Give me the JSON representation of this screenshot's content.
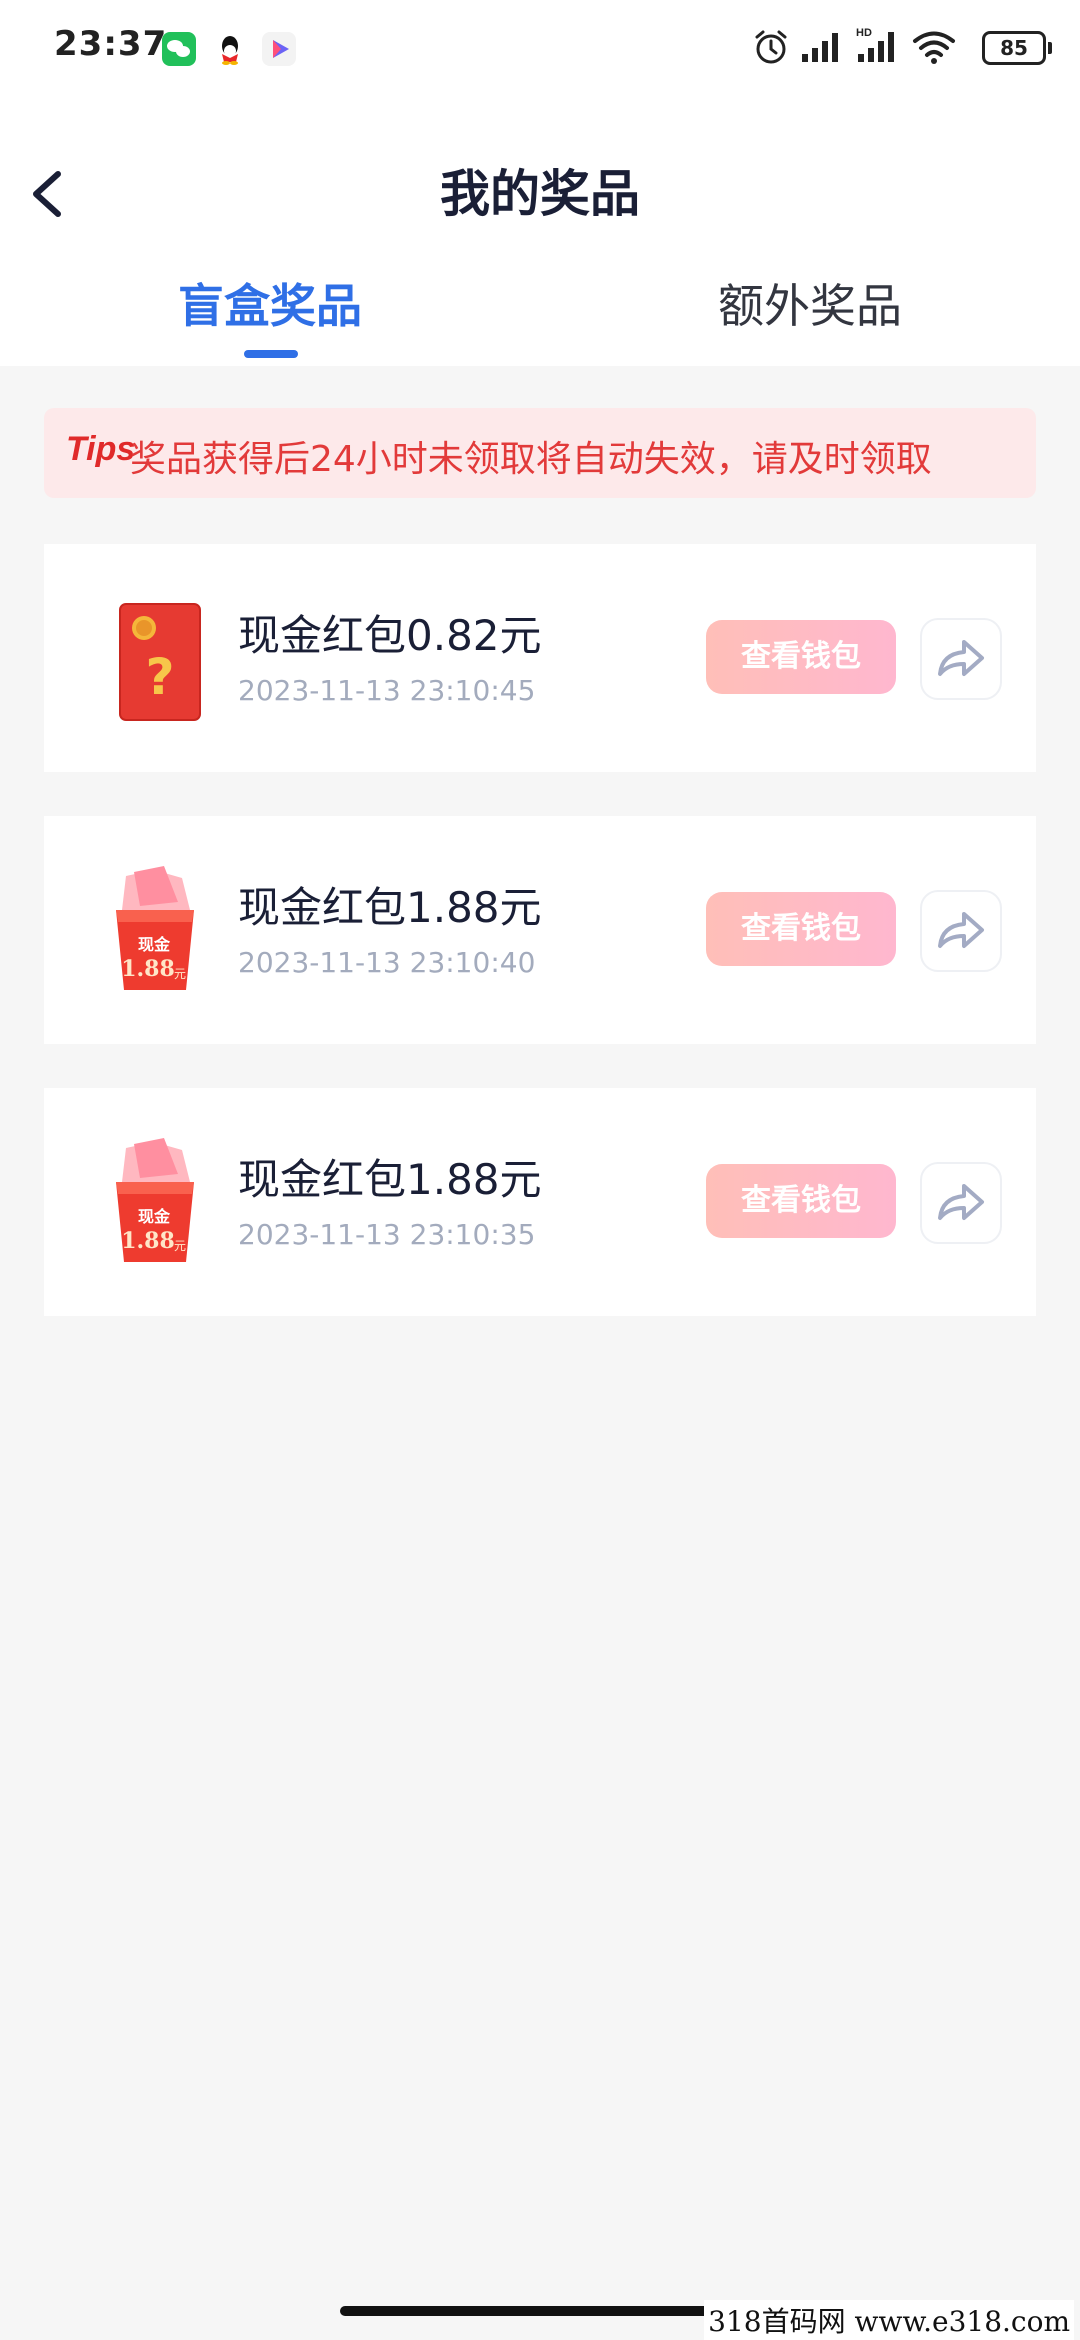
{
  "status_bar": {
    "time": "23:37",
    "battery": "85",
    "icons": [
      "wechat-icon",
      "qq-icon",
      "video-icon",
      "alarm-icon",
      "signal-icon",
      "hd-signal-icon",
      "wifi-icon",
      "battery-icon"
    ]
  },
  "header": {
    "title": "我的奖品",
    "back_icon": "chevron-left-icon"
  },
  "tabs": [
    {
      "label": "盲盒奖品",
      "active": true
    },
    {
      "label": "额外奖品",
      "active": false
    }
  ],
  "tip": {
    "label": "Tips",
    "text": "奖品获得后24小时未领取将自动失效，请及时领取"
  },
  "prizes": [
    {
      "title": "现金红包0.82元",
      "time": "2023-11-13 23:10:45",
      "button": "查看钱包",
      "icon": "red-envelope-question-icon"
    },
    {
      "title": "现金红包1.88元",
      "time": "2023-11-13 23:10:40",
      "button": "查看钱包",
      "icon": "cash-bag-icon",
      "icon_text": [
        "现金",
        "1.88",
        "元"
      ]
    },
    {
      "title": "现金红包1.88元",
      "time": "2023-11-13 23:10:35",
      "button": "查看钱包",
      "icon": "cash-bag-icon",
      "icon_text": [
        "现金",
        "1.88",
        "元"
      ]
    }
  ],
  "footer": {
    "watermark": "318首码网  www.e318.com"
  },
  "colors": {
    "accent": "#2f6fe6",
    "tip_bg": "#fde9ea",
    "tip_text": "#e23a3a",
    "button_gradient_start": "#ffbfb8",
    "button_gradient_end": "#ffb7cf"
  }
}
